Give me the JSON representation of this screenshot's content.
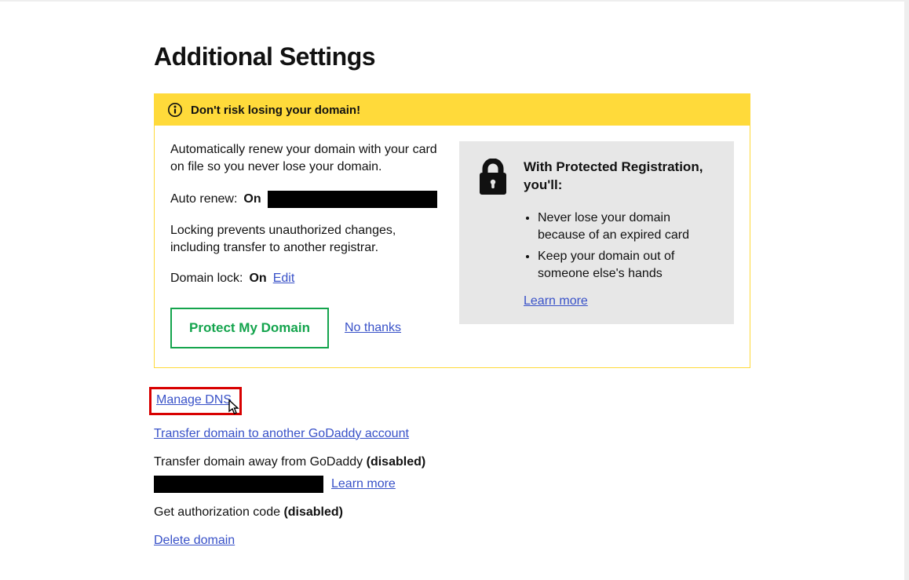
{
  "title": "Additional Settings",
  "alert": {
    "header": "Don't risk losing your domain!",
    "autorenew_desc": "Automatically renew your domain with your card on file so you never lose your domain.",
    "autorenew_label": "Auto renew:",
    "autorenew_value": "On",
    "locking_desc": "Locking prevents unauthorized changes, including transfer to another registrar.",
    "domainlock_label": "Domain lock:",
    "domainlock_value": "On",
    "edit_link": "Edit",
    "protect_btn": "Protect My Domain",
    "no_thanks": "No thanks"
  },
  "promo": {
    "heading": "With Protected Registration, you'll:",
    "bullet1": "Never lose your domain because of an expired card",
    "bullet2": "Keep your domain out of someone else's hands",
    "learn_more": "Learn more"
  },
  "links": {
    "manage_dns": "Manage DNS",
    "transfer_internal": "Transfer domain to another GoDaddy account",
    "transfer_away_prefix": "Transfer domain away from GoDaddy ",
    "disabled": "(disabled)",
    "learn_more": "Learn more",
    "get_auth_prefix": "Get authorization code ",
    "delete": "Delete domain"
  }
}
